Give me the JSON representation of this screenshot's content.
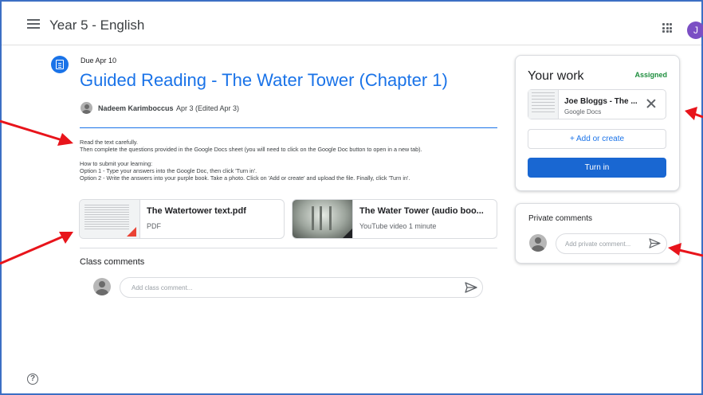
{
  "header": {
    "class_name": "Year 5 - English",
    "avatar_initial": "J"
  },
  "assignment": {
    "due": "Due Apr 10",
    "title": "Guided Reading - The Water Tower (Chapter 1)",
    "author": "Nadeem Karimboccus",
    "posted": "Apr 3 (Edited Apr 3)",
    "description": [
      "Read the text carefully.",
      "Then complete the questions provided in the Google Docs sheet (you will need to click on the Google Doc button to open in a new tab).",
      "",
      "How to submit your learning:",
      "Option 1 - Type your answers into the Google Doc, then click 'Turn in'.",
      "Option 2 - Write the answers into your purple book. Take a photo. Click on 'Add or create' and upload the file. Finally, click 'Turn in'."
    ],
    "attachments": [
      {
        "title": "The Watertower text.pdf",
        "subtitle": "PDF",
        "icon": "pdf-icon"
      },
      {
        "title": "The Water Tower (audio boo...",
        "subtitle": "YouTube video  1 minute",
        "icon": "video-icon"
      }
    ]
  },
  "class_comments": {
    "heading": "Class comments",
    "placeholder": "Add class comment..."
  },
  "your_work": {
    "heading": "Your work",
    "status": "Assigned",
    "file_name": "Joe Bloggs - The ...",
    "file_type": "Google Docs",
    "add_label": "+ Add or create",
    "turn_in_label": "Turn in"
  },
  "private_comments": {
    "heading": "Private comments",
    "placeholder": "Add private comment..."
  },
  "colors": {
    "accent": "#1a73e8",
    "assigned": "#1e8e3e",
    "annotation_arrow": "#e8141b",
    "frame": "#3c6fc4"
  }
}
